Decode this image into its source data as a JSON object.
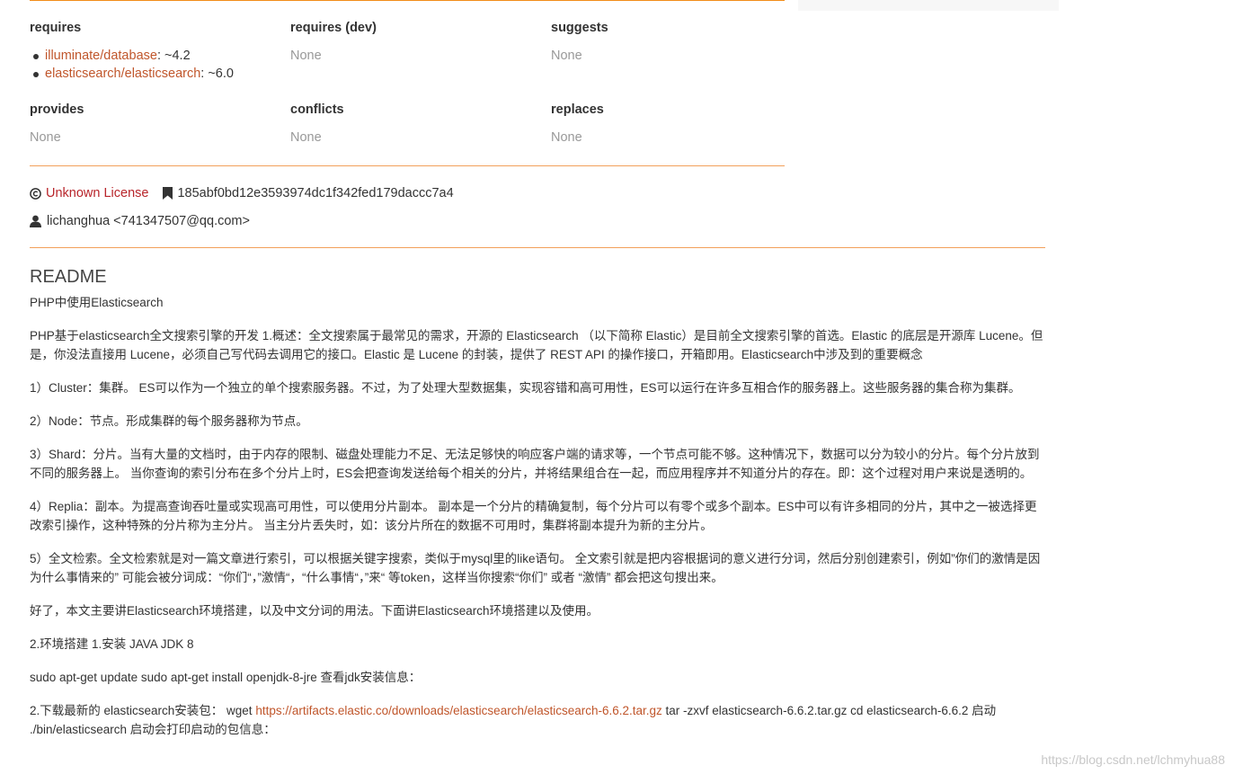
{
  "package_links": {
    "requires": {
      "heading": "requires",
      "items": [
        {
          "name": "illuminate/database",
          "version": ": ~4.2"
        },
        {
          "name": "elasticsearch/elasticsearch",
          "version": ": ~6.0"
        }
      ]
    },
    "requires_dev": {
      "heading": "requires (dev)",
      "value": "None"
    },
    "suggests": {
      "heading": "suggests",
      "value": "None"
    },
    "provides": {
      "heading": "provides",
      "value": "None"
    },
    "conflicts": {
      "heading": "conflicts",
      "value": "None"
    },
    "replaces": {
      "heading": "replaces",
      "value": "None"
    }
  },
  "meta": {
    "license_icon": "copyright-icon",
    "license": "Unknown License",
    "commit_icon": "bookmark-icon",
    "commit_hash": "185abf0bd12e3593974dc1f342fed179daccc7a4",
    "author_icon": "user-icon",
    "author": "lichanghua <741347507@qq.com>"
  },
  "readme": {
    "title": "README",
    "paragraphs": [
      "PHP中使用Elasticsearch",
      "PHP基于elasticsearch全文搜索引擎的开发 1.概述：全文搜索属于最常见的需求，开源的 Elasticsearch （以下简称 Elastic）是目前全文搜索引擎的首选。Elastic 的底层是开源库 Lucene。但是，你没法直接用 Lucene，必须自己写代码去调用它的接口。Elastic 是 Lucene 的封装，提供了 REST API 的操作接口，开箱即用。Elasticsearch中涉及到的重要概念",
      "1）Cluster：集群。 ES可以作为一个独立的单个搜索服务器。不过，为了处理大型数据集，实现容错和高可用性，ES可以运行在许多互相合作的服务器上。这些服务器的集合称为集群。",
      "2）Node：节点。形成集群的每个服务器称为节点。",
      "3）Shard：分片。当有大量的文档时，由于内存的限制、磁盘处理能力不足、无法足够快的响应客户端的请求等，一个节点可能不够。这种情况下，数据可以分为较小的分片。每个分片放到不同的服务器上。 当你查询的索引分布在多个分片上时，ES会把查询发送给每个相关的分片，并将结果组合在一起，而应用程序并不知道分片的存在。即：这个过程对用户来说是透明的。",
      "4）Replia：副本。为提高查询吞吐量或实现高可用性，可以使用分片副本。 副本是一个分片的精确复制，每个分片可以有零个或多个副本。ES中可以有许多相同的分片，其中之一被选择更改索引操作，这种特殊的分片称为主分片。 当主分片丢失时，如：该分片所在的数据不可用时，集群将副本提升为新的主分片。",
      "5）全文检索。全文检索就是对一篇文章进行索引，可以根据关键字搜索，类似于mysql里的like语句。 全文索引就是把内容根据词的意义进行分词，然后分别创建索引，例如”你们的激情是因为什么事情来的” 可能会被分词成：“你们“，”激情“，“什么事情“，”来“ 等token，这样当你搜索“你们” 或者 “激情” 都会把这句搜出来。",
      "好了，本文主要讲Elasticsearch环境搭建，以及中文分词的用法。下面讲Elasticsearch环境搭建以及使用。",
      "2.环境搭建 1.安装 JAVA JDK 8",
      "sudo apt-get update sudo apt-get install openjdk-8-jre 查看jdk安装信息："
    ],
    "download_prefix": "2.下载最新的 elasticsearch安装包： wget ",
    "download_url": "https://artifacts.elastic.co/downloads/elasticsearch/elasticsearch-6.6.2.tar.gz",
    "download_suffix": " tar -zxvf elasticsearch-6.6.2.tar.gz cd elasticsearch-6.6.2 启动 ./bin/elasticsearch 启动会打印启动的包信息："
  },
  "watermark": "https://blog.csdn.net/lchmyhua88",
  "colors": {
    "accent_rule": "#f28d1a",
    "link": "#c0562b",
    "license_link": "#b8252b",
    "muted": "#999999"
  }
}
